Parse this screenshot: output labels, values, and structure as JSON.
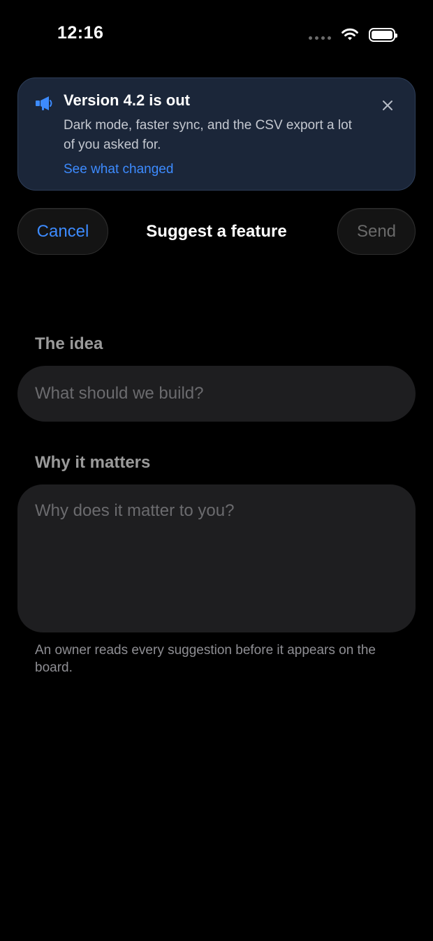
{
  "status_bar": {
    "time": "12:16",
    "icons": [
      "signal-dots-icon",
      "wifi-icon",
      "battery-icon"
    ]
  },
  "banner": {
    "icon": "megaphone-icon",
    "title": "Version 4.2 is out",
    "body": "Dark mode, faster sync, and the CSV export a lot of you asked for.",
    "link": "See what changed",
    "close_icon": "close-icon"
  },
  "nav": {
    "cancel": "Cancel",
    "title": "Suggest a feature",
    "send": "Send"
  },
  "form": {
    "idea_label": "The idea",
    "idea_placeholder": "What should we build?",
    "why_label": "Why it matters",
    "why_placeholder": "Why does it matter to you?",
    "footnote": "An owner reads every suggestion before it appears on the board."
  },
  "colors": {
    "accent": "#3d8bff",
    "banner_bg": "#1b2639",
    "field_bg": "#1e1e20",
    "disabled": "#6a6a6a"
  }
}
